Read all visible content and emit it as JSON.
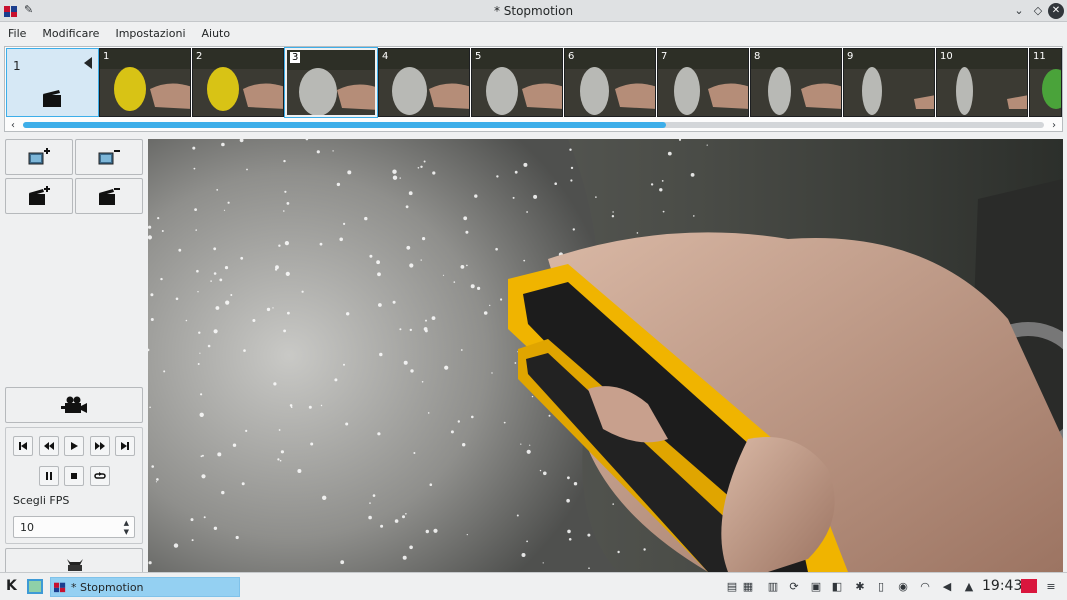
{
  "window": {
    "title": "* Stopmotion"
  },
  "menu": [
    "File",
    "Modificare",
    "Impostazioni",
    "Aiuto"
  ],
  "scene": {
    "number": "1"
  },
  "frames": [
    "1",
    "2",
    "3",
    "4",
    "5",
    "6",
    "7",
    "8",
    "9",
    "10",
    "11"
  ],
  "selected_frame": "3",
  "filmstrip_scroll": {
    "thumb_fraction": 0.63
  },
  "controls": {
    "fps_label": "Scegli FPS",
    "fps_value": "10"
  },
  "taskbar": {
    "task_label": "* Stopmotion",
    "clock": "19:43"
  },
  "icons": {
    "title": [
      "app-icon",
      "pin-icon",
      "minimize-icon",
      "maximize-icon",
      "close-icon"
    ],
    "toolbar": [
      "add-frames-icon",
      "remove-frames-icon",
      "add-scene-icon",
      "remove-scene-icon",
      "camera-icon"
    ],
    "playback": [
      "first-frame-icon",
      "previous-frame-icon",
      "play-icon",
      "next-frame-icon",
      "last-frame-icon",
      "pause-icon",
      "stop-icon",
      "loop-icon"
    ],
    "tray": [
      "clipboard-icon",
      "update-icon",
      "screenshot-icon",
      "display-icon",
      "bluetooth-icon",
      "usb-icon",
      "media-icon",
      "wifi-icon",
      "volume-icon",
      "arrow-up-icon",
      "notes-icon",
      "menu-icon"
    ]
  },
  "colors": {
    "accent": "#3daee9",
    "task_highlight": "#94d0f2",
    "balloon_yellow": "#d8c315"
  }
}
